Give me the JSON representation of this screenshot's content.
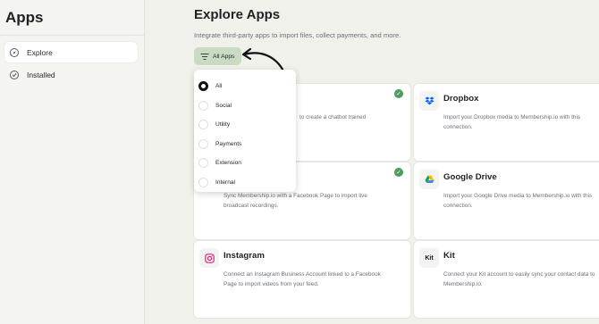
{
  "sidebar": {
    "title": "Apps",
    "items": [
      {
        "label": "Explore",
        "icon": "compass-icon",
        "active": true
      },
      {
        "label": "Installed",
        "icon": "check-circle-icon",
        "active": false
      }
    ]
  },
  "main": {
    "title": "Explore Apps",
    "subtitle": "Integrate third-party apps to import files, collect payments, and more.",
    "filter_label": "All Apps"
  },
  "filter_menu": {
    "options": [
      "All",
      "Social",
      "Utility",
      "Payments",
      "Extension",
      "Internal"
    ],
    "selected": "All"
  },
  "cards": [
    {
      "title": "",
      "desc": "to create a chatbot trained",
      "installed": true,
      "icon": "app-icon"
    },
    {
      "title": "Dropbox",
      "desc": "Import your Dropbox media to Membership.io with this connection.",
      "installed": false,
      "icon": "dropbox-icon"
    },
    {
      "title": "",
      "desc": "Sync Membership.io with a Facebook Page to import live broadcast recordings.",
      "installed": true,
      "icon": "facebook-icon"
    },
    {
      "title": "Google Drive",
      "desc": "Import your Google Drive media to Membership.io with this connection.",
      "installed": false,
      "icon": "google-drive-icon"
    },
    {
      "title": "Instagram",
      "desc": "Connect an Instagram Business Account linked to a Facebook Page to import videos from your feed.",
      "installed": false,
      "icon": "instagram-icon"
    },
    {
      "title": "Kit",
      "desc": "Connect your Kit account to easily sync your contact data to Membership.io.",
      "installed": false,
      "icon": "kit-icon",
      "logo_text": "Kit"
    }
  ],
  "colors": {
    "accent": "#c9dcc3",
    "installed": "#4e9a5b",
    "instagram": "#d62976",
    "dropbox": "#0061fe"
  }
}
